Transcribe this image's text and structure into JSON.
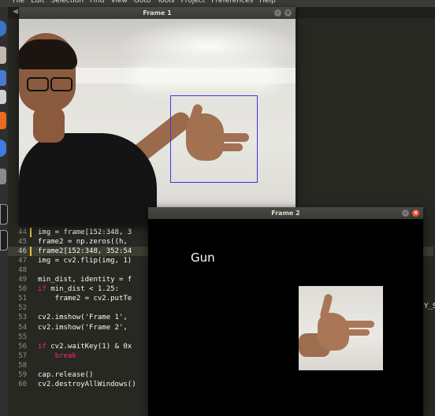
{
  "menubar": {
    "items": [
      "File",
      "Edit",
      "Selection",
      "Find",
      "View",
      "Goto",
      "Tools",
      "Project",
      "Preferences",
      "Help"
    ]
  },
  "editor": {
    "tab_arrow": "◀",
    "right_snippet": "Y_S",
    "lines": [
      {
        "n": "44",
        "code": "img = frame[152:348, 3"
      },
      {
        "n": "45",
        "code": "frame2 = np.zeros((h, "
      },
      {
        "n": "46",
        "code": "frame2[152:348, 352:54",
        "hl": true
      },
      {
        "n": "47",
        "code": "img = cv2.flip(img, 1)"
      },
      {
        "n": "48",
        "code": ""
      },
      {
        "n": "49",
        "code": "min_dist, identity = f"
      },
      {
        "n": "50",
        "code": "if min_dist < 1.25:"
      },
      {
        "n": "51",
        "code": "    frame2 = cv2.putTe"
      },
      {
        "n": "52",
        "code": ""
      },
      {
        "n": "53",
        "code": "cv2.imshow('Frame 1',"
      },
      {
        "n": "54",
        "code": "cv2.imshow('Frame 2',"
      },
      {
        "n": "55",
        "code": ""
      },
      {
        "n": "56",
        "code": "if cv2.waitKey(1) & 0x"
      },
      {
        "n": "57",
        "code": "    break"
      },
      {
        "n": "58",
        "code": ""
      },
      {
        "n": "59",
        "code": "cap.release()"
      },
      {
        "n": "60",
        "code": "cv2.destroyAllWindows()"
      }
    ]
  },
  "frame1": {
    "title": "Frame 1",
    "minimize": "–",
    "close": "×"
  },
  "frame2": {
    "title": "Frame 2",
    "minimize": "–",
    "close": "×",
    "prediction": "Gun"
  },
  "colors": {
    "roi_box": "#3a39d6",
    "editor_bg": "#272822",
    "close_active": "#e8582b"
  }
}
